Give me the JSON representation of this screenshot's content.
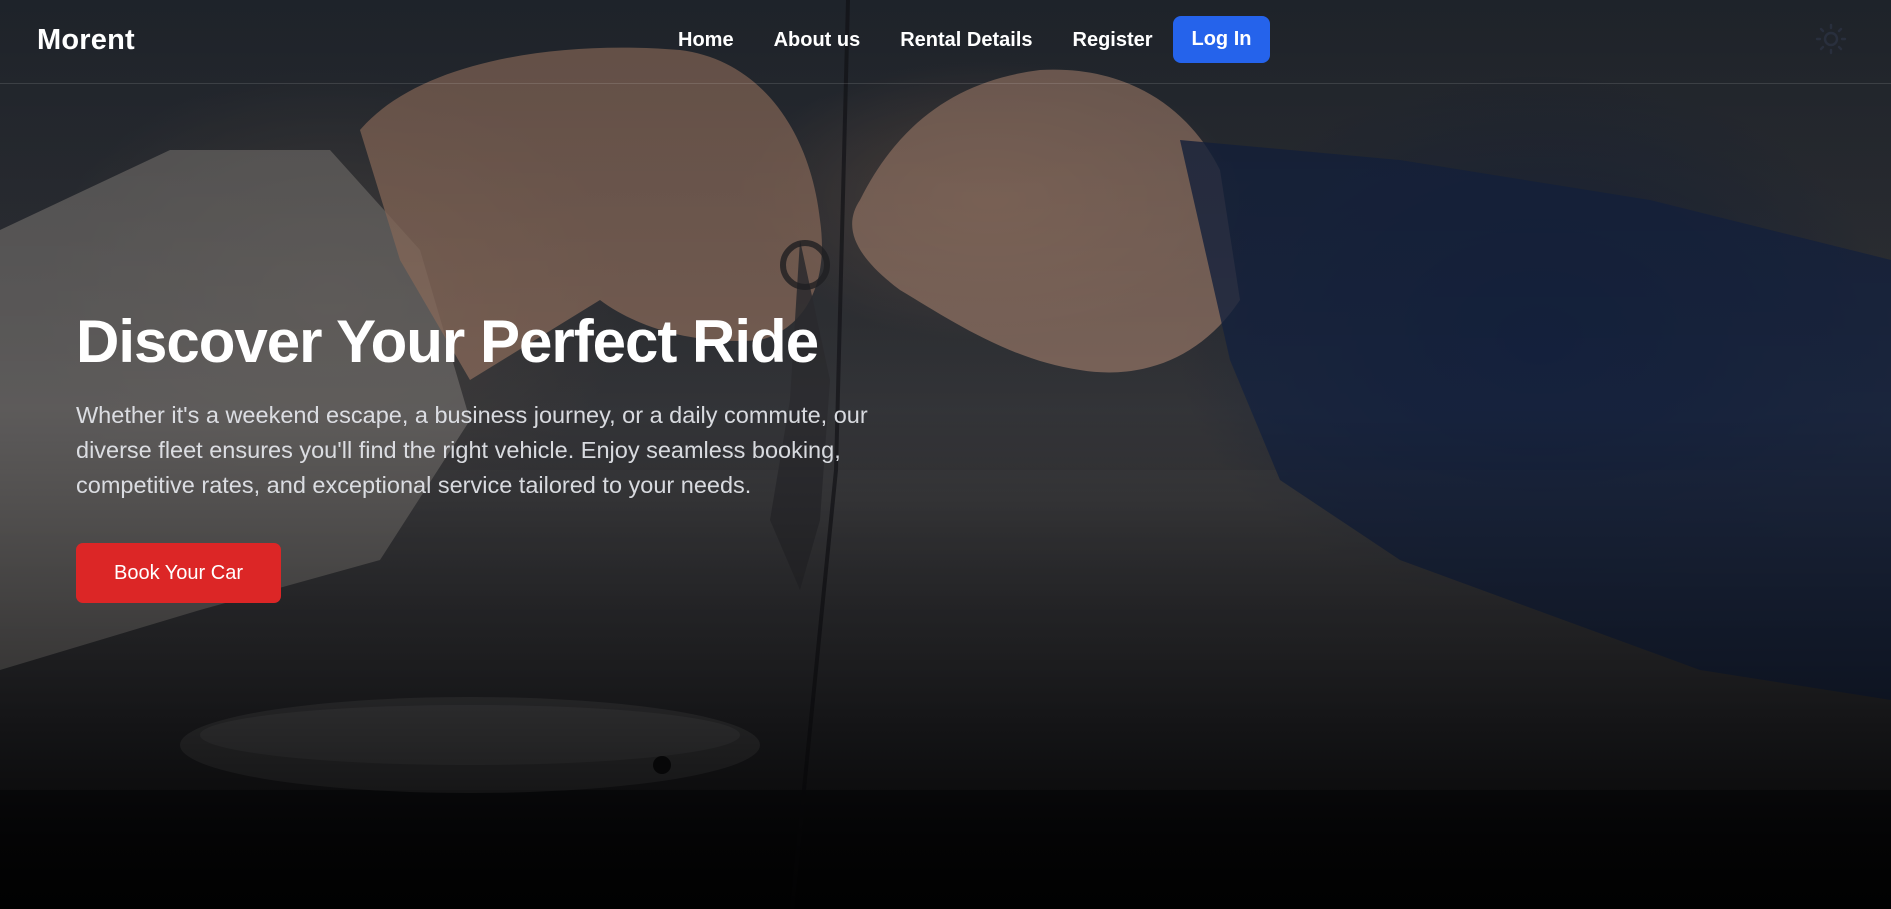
{
  "brand": {
    "name": "Morent"
  },
  "nav": {
    "links": [
      {
        "label": "Home"
      },
      {
        "label": "About us"
      },
      {
        "label": "Rental Details"
      },
      {
        "label": "Register"
      }
    ],
    "login_label": "Log In",
    "theme_icon": "sun-icon"
  },
  "hero": {
    "title": "Discover Your Perfect Ride",
    "description": "Whether it's a weekend escape, a business journey, or a daily commute, our diverse fleet ensures you'll find the right vehicle. Enjoy seamless booking, competitive rates, and exceptional service tailored to your needs.",
    "cta_label": "Book Your Car",
    "background_image": "hands-exchanging-car-keys"
  },
  "colors": {
    "login_button": "#2563eb",
    "cta_button": "#dc2626",
    "text": "#ffffff"
  }
}
